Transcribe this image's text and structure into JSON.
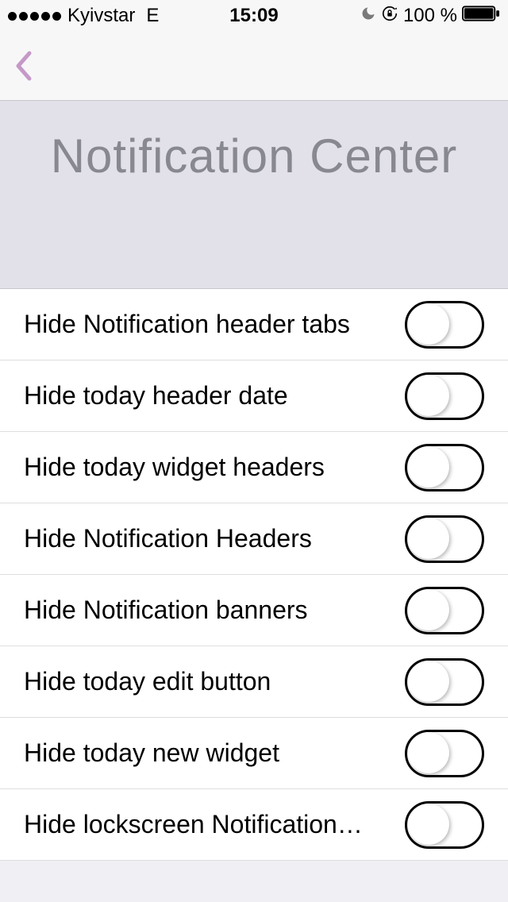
{
  "status_bar": {
    "carrier": "Kyivstar",
    "network": "E",
    "time": "15:09",
    "battery_text": "100 %"
  },
  "page": {
    "title": "Notification Center"
  },
  "settings": [
    {
      "label": "Hide Notification header tabs"
    },
    {
      "label": "Hide today header date"
    },
    {
      "label": "Hide today widget headers"
    },
    {
      "label": "Hide Notification Headers"
    },
    {
      "label": "Hide Notification banners"
    },
    {
      "label": "Hide today edit button"
    },
    {
      "label": "Hide today new widget"
    },
    {
      "label": "Hide lockscreen Notification…"
    }
  ]
}
